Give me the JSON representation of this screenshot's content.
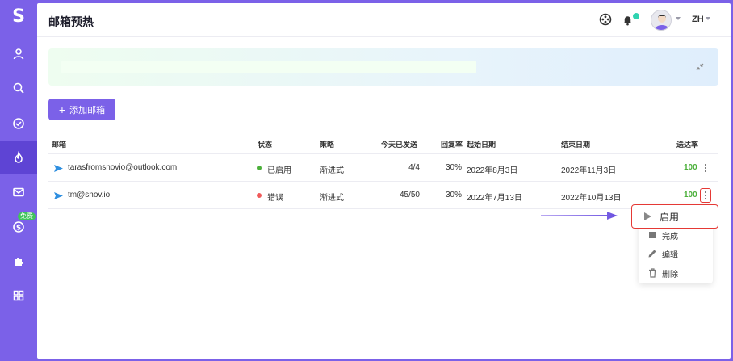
{
  "sidebar": {
    "logo": "S",
    "free_badge": "免费",
    "items": [
      {
        "icon": "person-icon"
      },
      {
        "icon": "search-icon"
      },
      {
        "icon": "check-circle-icon"
      },
      {
        "icon": "flame-icon",
        "active": true
      },
      {
        "icon": "mail-icon"
      },
      {
        "icon": "dollar-icon"
      },
      {
        "icon": "puzzle-icon"
      },
      {
        "icon": "grid-icon"
      }
    ]
  },
  "header": {
    "title": "邮箱预热",
    "lang": "ZH"
  },
  "toolbar": {
    "add_label": "添加邮箱",
    "add_plus": "+"
  },
  "table": {
    "columns": {
      "mailbox": "邮箱",
      "status": "状态",
      "strategy": "策略",
      "sent_today": "今天已发送",
      "reply_rate": "回复率",
      "start_date": "起始日期",
      "end_date": "结束日期",
      "delivery_rate": "送达率"
    },
    "rows": [
      {
        "email": "tarasfromsnovio@outlook.com",
        "status": "已启用",
        "status_color": "#4cb03b",
        "strategy": "渐进式",
        "sent_today": "4/4",
        "reply_rate": "30%",
        "start_date": "2022年8月3日",
        "end_date": "2022年11月3日",
        "delivery_rate": "100"
      },
      {
        "email": "tm@snov.io",
        "status": "错误",
        "status_color": "#f05a5a",
        "strategy": "渐进式",
        "sent_today": "45/50",
        "reply_rate": "30%",
        "start_date": "2022年7月13日",
        "end_date": "2022年10月13日",
        "delivery_rate": "100"
      }
    ]
  },
  "menu": {
    "items": [
      {
        "label": "启用",
        "icon": "play-icon"
      },
      {
        "label": "完成",
        "icon": "stop-icon"
      },
      {
        "label": "编辑",
        "icon": "pencil-icon"
      },
      {
        "label": "删除",
        "icon": "trash-icon"
      }
    ]
  },
  "colors": {
    "accent": "#7b61e8",
    "highlight": "#e53935",
    "success": "#4cb03b"
  }
}
